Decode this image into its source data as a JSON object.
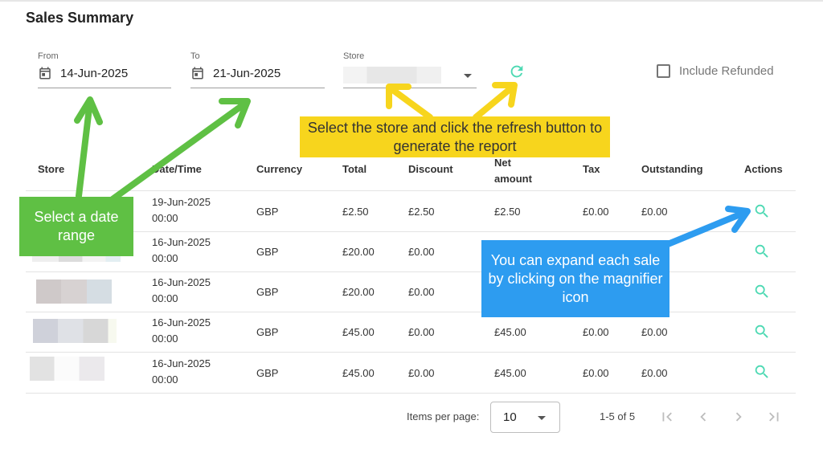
{
  "page": {
    "title": "Sales Summary"
  },
  "filters": {
    "from_label": "From",
    "from_value": "14-Jun-2025",
    "to_label": "To",
    "to_value": "21-Jun-2025",
    "store_label": "Store",
    "include_refunded_label": "Include Refunded",
    "include_refunded_checked": false
  },
  "table": {
    "headers": {
      "store": "Store",
      "datetime": "Date/Time",
      "currency": "Currency",
      "total": "Total",
      "discount": "Discount",
      "net_amount_1": "Net",
      "net_amount_2": "amount",
      "tax": "Tax",
      "outstanding": "Outstanding",
      "actions": "Actions"
    },
    "rows": [
      {
        "date": "19-Jun-2025",
        "time": "00:00",
        "currency": "GBP",
        "total": "£2.50",
        "discount": "£2.50",
        "net": "£2.50",
        "tax": "£0.00",
        "outstanding": "£0.00"
      },
      {
        "date": "16-Jun-2025",
        "time": "00:00",
        "currency": "GBP",
        "total": "£20.00",
        "discount": "£0.00",
        "net": "",
        "tax": "",
        "outstanding": ""
      },
      {
        "date": "16-Jun-2025",
        "time": "00:00",
        "currency": "GBP",
        "total": "£20.00",
        "discount": "£0.00",
        "net": "",
        "tax": "",
        "outstanding": ""
      },
      {
        "date": "16-Jun-2025",
        "time": "00:00",
        "currency": "GBP",
        "total": "£45.00",
        "discount": "£0.00",
        "net": "£45.00",
        "tax": "£0.00",
        "outstanding": "£0.00"
      },
      {
        "date": "16-Jun-2025",
        "time": "00:00",
        "currency": "GBP",
        "total": "£45.00",
        "discount": "£0.00",
        "net": "£45.00",
        "tax": "£0.00",
        "outstanding": "£0.00"
      }
    ]
  },
  "paginator": {
    "items_per_page_label": "Items per page:",
    "items_per_page_value": "10",
    "range_label": "1-5 of 5"
  },
  "callouts": {
    "store_refresh": "Select the store and click the refresh button to generate the report",
    "date_range": "Select a date range",
    "magnifier": "You can expand each sale by clicking on the magnifier icon"
  },
  "icons": {
    "calendar": "calendar-icon",
    "refresh": "refresh-icon",
    "magnifier": "magnifier-icon",
    "dropdown": "chevron-down-icon"
  },
  "colors": {
    "accent_teal": "#4dd9b3",
    "callout_yellow": "#f7d51d",
    "callout_green": "#5fc044",
    "callout_blue": "#2d9cf0"
  }
}
